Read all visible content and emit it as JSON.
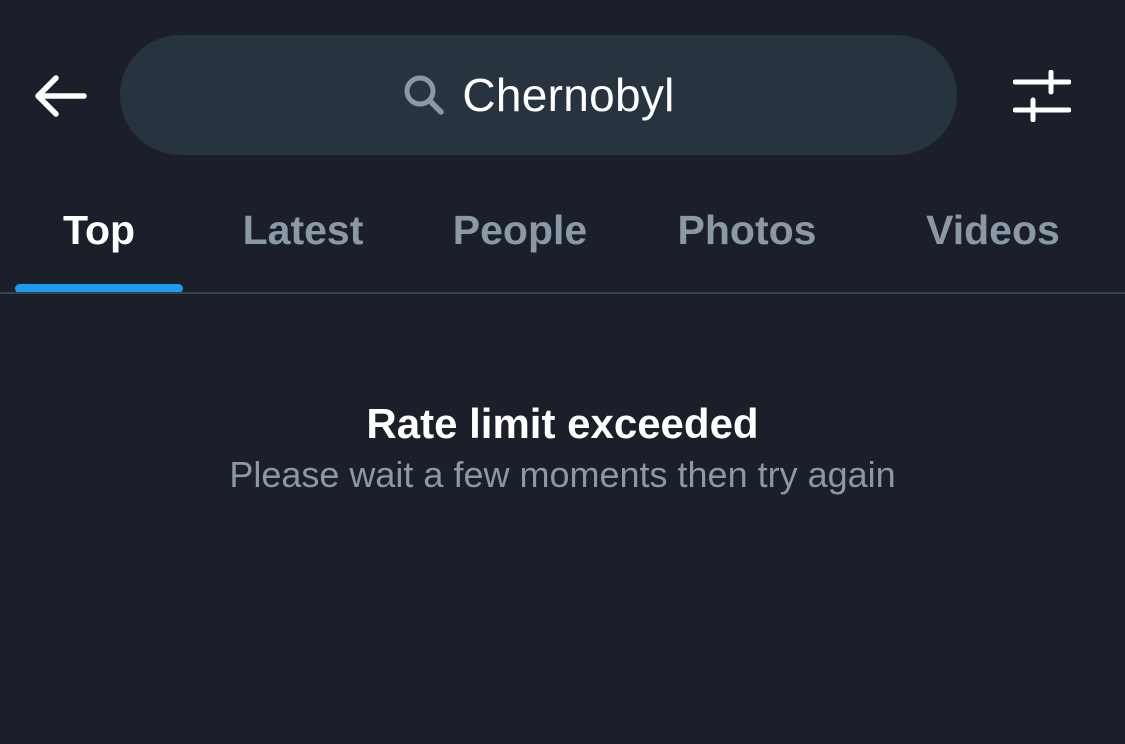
{
  "header": {
    "back_icon": "arrow-left-icon",
    "search": {
      "query": "Chernobyl",
      "icon": "search-icon"
    },
    "filter_icon": "sliders-icon"
  },
  "tabs": [
    {
      "label": "Top",
      "active": true
    },
    {
      "label": "Latest",
      "active": false
    },
    {
      "label": "People",
      "active": false
    },
    {
      "label": "Photos",
      "active": false
    },
    {
      "label": "Videos",
      "active": false
    }
  ],
  "message": {
    "title": "Rate limit exceeded",
    "subtitle": "Please wait a few moments then try again"
  },
  "colors": {
    "background": "#1a1f29",
    "search_background": "#283340",
    "accent": "#1d9bf0",
    "muted_text": "#8b98a5",
    "divider": "#38444d"
  }
}
